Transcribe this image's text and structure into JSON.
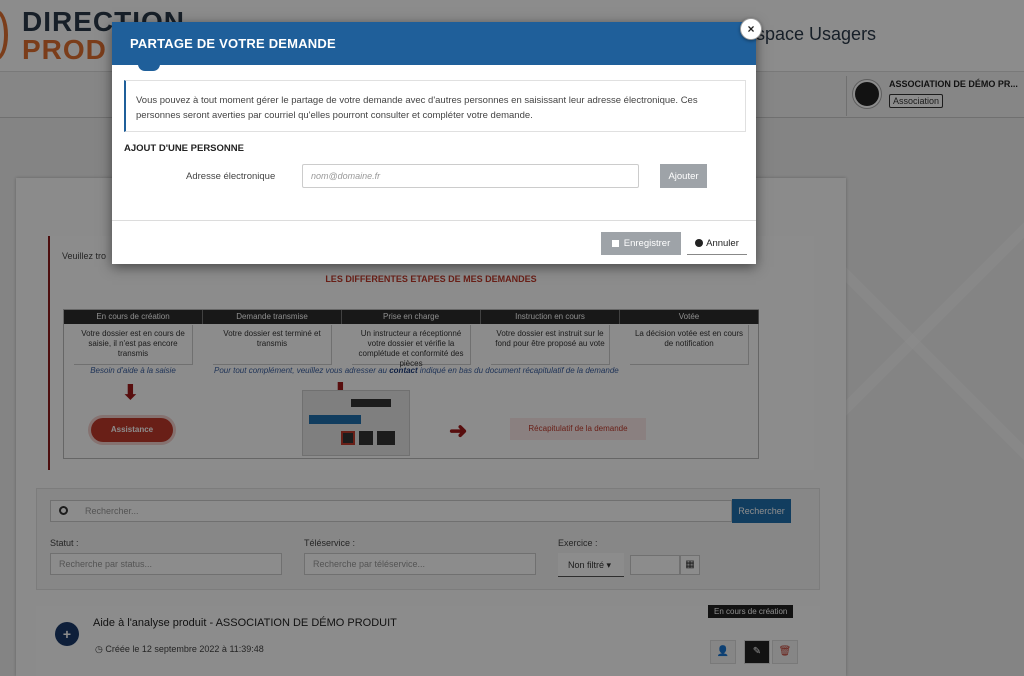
{
  "header": {
    "logo_line1": "DIRECTION",
    "logo_line2": "PROD",
    "espace": "space Usagers",
    "user_name": "ASSOCIATION DE DÉMO PR...",
    "user_badge": "Association"
  },
  "info": {
    "veuillez": "Veuillez tro",
    "steps_title": "LES DIFFERENTES ETAPES DE MES DEMANDES",
    "steps": [
      {
        "head": "En cours de création",
        "body": "Votre dossier est en cours de saisie, il n'est pas encore transmis"
      },
      {
        "head": "Demande transmise",
        "body": "Votre dossier est terminé et transmis"
      },
      {
        "head": "Prise en charge",
        "body": "Un instructeur a réceptionné votre dossier et vérifie la complétude et conformité des pièces"
      },
      {
        "head": "Instruction en cours",
        "body": "Votre dossier est instruit sur le fond pour être proposé au vote"
      },
      {
        "head": "Votée",
        "body": "La décision votée est en cours de notification"
      }
    ],
    "help_left": "Besoin d'aide à la saisie",
    "help_right_pre": "Pour tout complément, veuillez vous adresser au",
    "help_right_bold": "contact",
    "help_right_post": "indiqué en bas du document récapitulatif de la demande",
    "assistance": "Assistance",
    "recap": "Récapitulatif de la demande"
  },
  "search": {
    "placeholder": "Rechercher...",
    "button": "Rechercher",
    "statut_label": "Statut :",
    "statut_ph": "Recherche par status...",
    "teleservice_label": "Téléservice :",
    "teleservice_ph": "Recherche par téléservice...",
    "exercice_label": "Exercice :",
    "exercice_value": "Non filtré ▾"
  },
  "item": {
    "title": "Aide à l'analyse produit - ASSOCIATION DE DÉMO PRODUIT",
    "date": "Créée le 12 septembre 2022 à 11:39:48",
    "status": "En cours de création"
  },
  "modal": {
    "title": "PARTAGE DE VOTRE DEMANDE",
    "close": "×",
    "note": "Vous pouvez à tout moment gérer le partage de votre demande avec d'autres personnes en saisissant leur adresse électronique. Ces personnes seront averties par courriel qu'elles pourront consulter et compléter votre demande.",
    "section_title": "AJOUT D'UNE PERSONNE",
    "email_label": "Adresse électronique",
    "email_placeholder": "nom@domaine.fr",
    "add_button": "Ajouter",
    "save_button": "Enregistrer",
    "cancel_button": "Annuler"
  },
  "colors": {
    "modal_header": "#1f5f9a",
    "button_gray": "#9ea3a8",
    "accent_red": "#c0392b"
  }
}
